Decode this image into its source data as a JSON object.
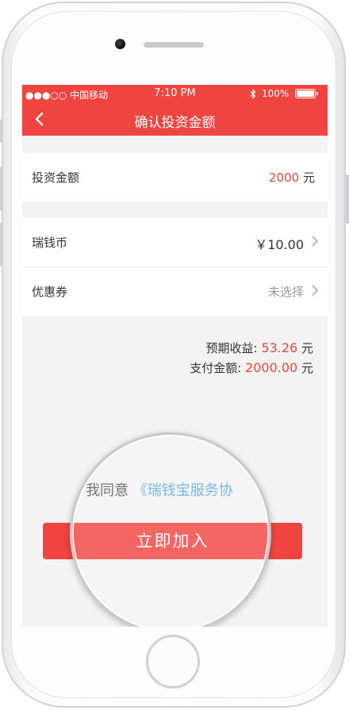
{
  "status": {
    "carrier": "●●●○○ 中国移动",
    "time": "7:10 PM",
    "battery": "100%"
  },
  "nav": {
    "title": "确认投资金额"
  },
  "invest": {
    "label": "投资金额",
    "amount": "2000",
    "unit": "元"
  },
  "coin": {
    "label": "瑞钱币",
    "value": "￥10.00"
  },
  "coupon": {
    "label": "优惠券",
    "value": "未选择"
  },
  "summary": {
    "earn_label": "预期收益:",
    "earn_value": "53.26",
    "pay_label": "支付金额:",
    "pay_value": "2000.00",
    "unit": "元"
  },
  "agreement": {
    "prefix": "我同意",
    "link": "《瑞钱宝服务协"
  },
  "join_button": "立即加入",
  "colors": {
    "accent": "#f04440",
    "amount_red": "#e8453c",
    "link_blue": "#5ea8d8"
  },
  "icons": [
    "back-icon",
    "bluetooth-icon",
    "battery-icon",
    "chevron-right-icon"
  ]
}
